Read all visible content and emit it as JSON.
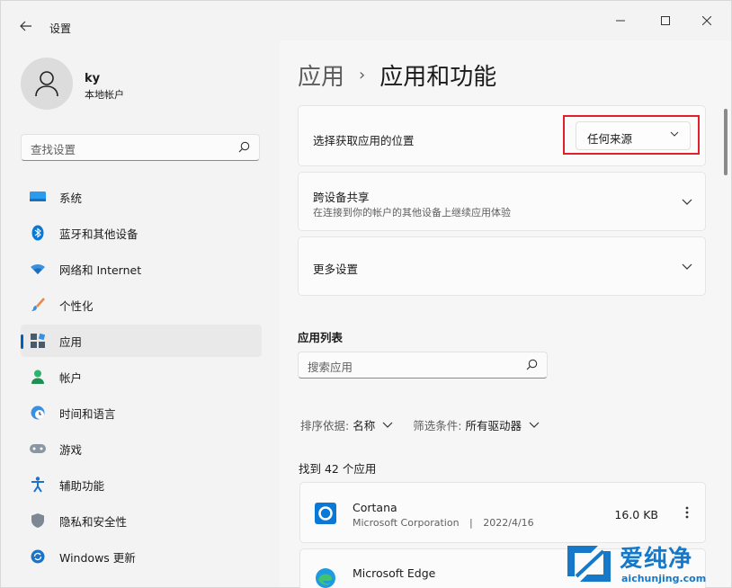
{
  "window": {
    "title": "设置"
  },
  "user": {
    "name": "ky",
    "account_type": "本地帐户"
  },
  "search": {
    "placeholder": "查找设置"
  },
  "sidebar": {
    "items": [
      {
        "label": "系统",
        "icon": "monitor-icon"
      },
      {
        "label": "蓝牙和其他设备",
        "icon": "bluetooth-icon"
      },
      {
        "label": "网络和 Internet",
        "icon": "wifi-icon"
      },
      {
        "label": "个性化",
        "icon": "brush-icon"
      },
      {
        "label": "应用",
        "icon": "apps-icon",
        "active": true
      },
      {
        "label": "帐户",
        "icon": "person-icon"
      },
      {
        "label": "时间和语言",
        "icon": "clock-globe-icon"
      },
      {
        "label": "游戏",
        "icon": "gamepad-icon"
      },
      {
        "label": "辅助功能",
        "icon": "accessibility-icon"
      },
      {
        "label": "隐私和安全性",
        "icon": "shield-icon"
      },
      {
        "label": "Windows 更新",
        "icon": "update-icon"
      }
    ]
  },
  "breadcrumb": {
    "parent": "应用",
    "separator": "›",
    "current": "应用和功能"
  },
  "settings": {
    "install_source": {
      "label": "选择获取应用的位置",
      "value": "任何来源"
    },
    "share": {
      "title": "跨设备共享",
      "subtitle": "在连接到你的帐户的其他设备上继续应用体验"
    },
    "more": {
      "title": "更多设置"
    }
  },
  "app_list": {
    "title": "应用列表",
    "search_placeholder": "搜索应用",
    "sort_label": "排序依据:",
    "sort_value": "名称",
    "filter_label": "筛选条件:",
    "filter_value": "所有驱动器",
    "found": "找到 42 个应用",
    "apps": [
      {
        "name": "Cortana",
        "publisher": "Microsoft Corporation",
        "sep": "|",
        "date": "2022/4/16",
        "size": "16.0 KB"
      },
      {
        "name": "Microsoft Edge"
      }
    ]
  },
  "watermark": {
    "text": "爱纯净",
    "url": "aichunjing.com"
  },
  "colors": {
    "accent": "#005fb8",
    "highlight": "#e0212b",
    "watermark": "#1678c8"
  }
}
